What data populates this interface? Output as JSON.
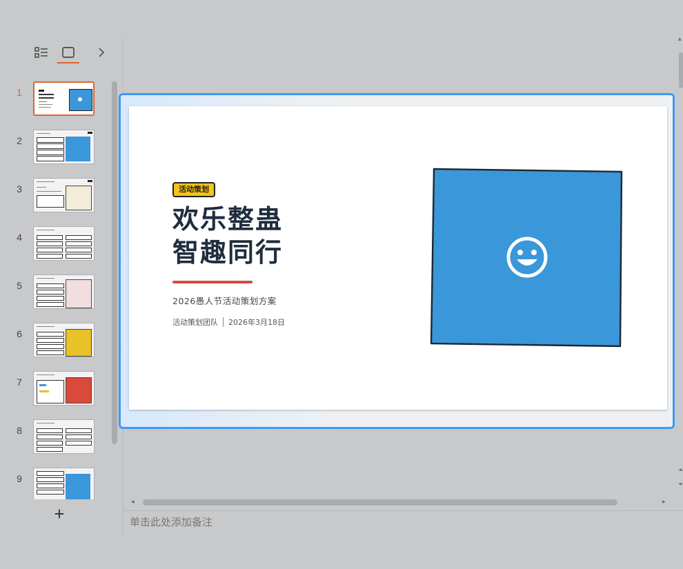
{
  "sidebar": {
    "outline_view_label": "outline-view",
    "slide_view_label": "slide-view",
    "expand_label": "expand",
    "thumbnails": [
      {
        "number": "1",
        "active": true
      },
      {
        "number": "2",
        "active": false
      },
      {
        "number": "3",
        "active": false
      },
      {
        "number": "4",
        "active": false
      },
      {
        "number": "5",
        "active": false
      },
      {
        "number": "6",
        "active": false
      },
      {
        "number": "7",
        "active": false
      },
      {
        "number": "8",
        "active": false
      },
      {
        "number": "9",
        "active": false
      }
    ],
    "add_label": "+"
  },
  "slide": {
    "badge": "活动策划",
    "title_line1": "欢乐整蛊",
    "title_line2": "智趣同行",
    "subtitle": "2026愚人节活动策划方案",
    "team": "活动策划团队",
    "date": "2026年3月18日",
    "accent_blue": "#3a97d9",
    "accent_yellow": "#f5c518",
    "accent_red": "#d94a3b",
    "icon": "smiley-icon"
  },
  "notes": {
    "placeholder": "单击此处添加备注"
  },
  "colors": {
    "selection_frame": "#3f98f5",
    "active_thumb": "#d9662e"
  }
}
